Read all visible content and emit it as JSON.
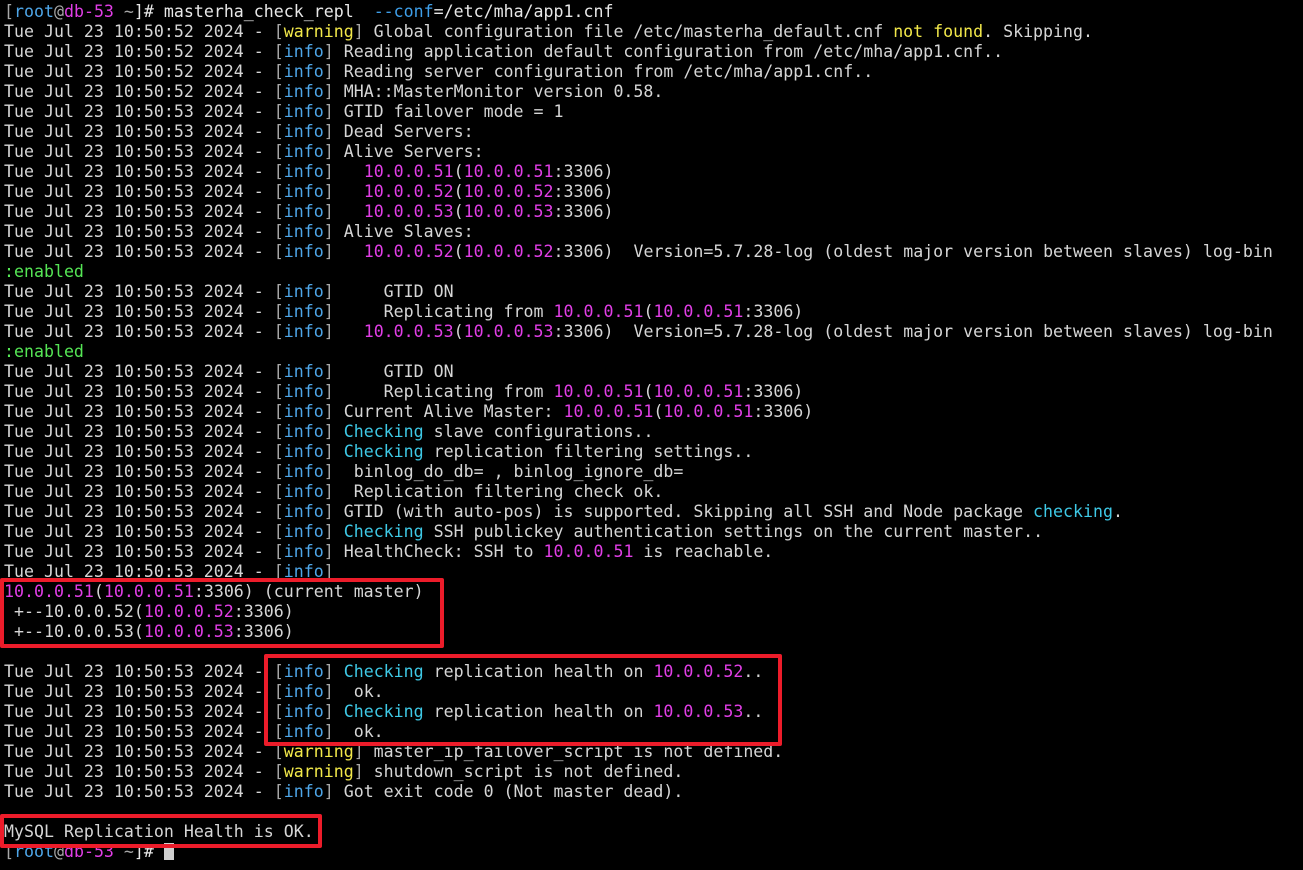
{
  "colors": {
    "background": "#000000",
    "text": "#d6d6d6",
    "warning": "#f2e84a",
    "info": "#4ea6e8",
    "ip": "#e13ee6",
    "keyword": "#3ec9e6",
    "enabled": "#55e655",
    "highlight_box": "#ec1c2a"
  },
  "icons": {
    "cursor": "block-cursor-icon"
  },
  "lines": [
    [
      {
        "t": "[",
        "c": "br"
      },
      {
        "t": "root",
        "c": "user"
      },
      {
        "t": "@",
        "c": "br"
      },
      {
        "t": "db-53",
        "c": "host"
      },
      {
        "t": " ~",
        "c": "br"
      },
      {
        "t": "]# masterha_check_repl  ",
        "c": "path"
      },
      {
        "t": "--conf",
        "c": "opt"
      },
      {
        "t": "=/etc/mha/app1.cnf",
        "c": "path"
      }
    ],
    [
      {
        "t": "Tue Jul 23 10:50:52 2024 - "
      },
      {
        "t": "[",
        "c": "br"
      },
      {
        "t": "warning",
        "c": "warn"
      },
      {
        "t": "]",
        "c": "br"
      },
      {
        "t": " Global configuration file /etc/masterha_default.cnf "
      },
      {
        "t": "not found",
        "c": "nf"
      },
      {
        "t": ". Skipping."
      }
    ],
    [
      {
        "t": "Tue Jul 23 10:50:52 2024 - "
      },
      {
        "t": "[",
        "c": "br"
      },
      {
        "t": "info",
        "c": "info"
      },
      {
        "t": "]",
        "c": "br"
      },
      {
        "t": " Reading application default configuration from /etc/mha/app1.cnf.."
      }
    ],
    [
      {
        "t": "Tue Jul 23 10:50:52 2024 - "
      },
      {
        "t": "[",
        "c": "br"
      },
      {
        "t": "info",
        "c": "info"
      },
      {
        "t": "]",
        "c": "br"
      },
      {
        "t": " Reading server configuration from /etc/mha/app1.cnf.."
      }
    ],
    [
      {
        "t": "Tue Jul 23 10:50:52 2024 - "
      },
      {
        "t": "[",
        "c": "br"
      },
      {
        "t": "info",
        "c": "info"
      },
      {
        "t": "]",
        "c": "br"
      },
      {
        "t": " MHA::MasterMonitor version 0.58."
      }
    ],
    [
      {
        "t": "Tue Jul 23 10:50:53 2024 - "
      },
      {
        "t": "[",
        "c": "br"
      },
      {
        "t": "info",
        "c": "info"
      },
      {
        "t": "]",
        "c": "br"
      },
      {
        "t": " GTID failover mode = 1"
      }
    ],
    [
      {
        "t": "Tue Jul 23 10:50:53 2024 - "
      },
      {
        "t": "[",
        "c": "br"
      },
      {
        "t": "info",
        "c": "info"
      },
      {
        "t": "]",
        "c": "br"
      },
      {
        "t": " Dead Servers:"
      }
    ],
    [
      {
        "t": "Tue Jul 23 10:50:53 2024 - "
      },
      {
        "t": "[",
        "c": "br"
      },
      {
        "t": "info",
        "c": "info"
      },
      {
        "t": "]",
        "c": "br"
      },
      {
        "t": " Alive Servers:"
      }
    ],
    [
      {
        "t": "Tue Jul 23 10:50:53 2024 - "
      },
      {
        "t": "[",
        "c": "br"
      },
      {
        "t": "info",
        "c": "info"
      },
      {
        "t": "]",
        "c": "br"
      },
      {
        "t": "   "
      },
      {
        "t": "10.0.0.51",
        "c": "ip"
      },
      {
        "t": "("
      },
      {
        "t": "10.0.0.51",
        "c": "ip"
      },
      {
        "t": ":3306)"
      }
    ],
    [
      {
        "t": "Tue Jul 23 10:50:53 2024 - "
      },
      {
        "t": "[",
        "c": "br"
      },
      {
        "t": "info",
        "c": "info"
      },
      {
        "t": "]",
        "c": "br"
      },
      {
        "t": "   "
      },
      {
        "t": "10.0.0.52",
        "c": "ip"
      },
      {
        "t": "("
      },
      {
        "t": "10.0.0.52",
        "c": "ip"
      },
      {
        "t": ":3306)"
      }
    ],
    [
      {
        "t": "Tue Jul 23 10:50:53 2024 - "
      },
      {
        "t": "[",
        "c": "br"
      },
      {
        "t": "info",
        "c": "info"
      },
      {
        "t": "]",
        "c": "br"
      },
      {
        "t": "   "
      },
      {
        "t": "10.0.0.53",
        "c": "ip"
      },
      {
        "t": "("
      },
      {
        "t": "10.0.0.53",
        "c": "ip"
      },
      {
        "t": ":3306)"
      }
    ],
    [
      {
        "t": "Tue Jul 23 10:50:53 2024 - "
      },
      {
        "t": "[",
        "c": "br"
      },
      {
        "t": "info",
        "c": "info"
      },
      {
        "t": "]",
        "c": "br"
      },
      {
        "t": " Alive Slaves:"
      }
    ],
    [
      {
        "t": "Tue Jul 23 10:50:53 2024 - "
      },
      {
        "t": "[",
        "c": "br"
      },
      {
        "t": "info",
        "c": "info"
      },
      {
        "t": "]",
        "c": "br"
      },
      {
        "t": "   "
      },
      {
        "t": "10.0.0.52",
        "c": "ip"
      },
      {
        "t": "("
      },
      {
        "t": "10.0.0.52",
        "c": "ip"
      },
      {
        "t": ":3306)  Version=5.7.28-log (oldest major version between slaves) log-bin"
      }
    ],
    [
      {
        "t": ":enabled",
        "c": "en"
      }
    ],
    [
      {
        "t": "Tue Jul 23 10:50:53 2024 - "
      },
      {
        "t": "[",
        "c": "br"
      },
      {
        "t": "info",
        "c": "info"
      },
      {
        "t": "]",
        "c": "br"
      },
      {
        "t": "     GTID ON"
      }
    ],
    [
      {
        "t": "Tue Jul 23 10:50:53 2024 - "
      },
      {
        "t": "[",
        "c": "br"
      },
      {
        "t": "info",
        "c": "info"
      },
      {
        "t": "]",
        "c": "br"
      },
      {
        "t": "     Replicating from "
      },
      {
        "t": "10.0.0.51",
        "c": "ip"
      },
      {
        "t": "("
      },
      {
        "t": "10.0.0.51",
        "c": "ip"
      },
      {
        "t": ":3306)"
      }
    ],
    [
      {
        "t": "Tue Jul 23 10:50:53 2024 - "
      },
      {
        "t": "[",
        "c": "br"
      },
      {
        "t": "info",
        "c": "info"
      },
      {
        "t": "]",
        "c": "br"
      },
      {
        "t": "   "
      },
      {
        "t": "10.0.0.53",
        "c": "ip"
      },
      {
        "t": "("
      },
      {
        "t": "10.0.0.53",
        "c": "ip"
      },
      {
        "t": ":3306)  Version=5.7.28-log (oldest major version between slaves) log-bin"
      }
    ],
    [
      {
        "t": ":enabled",
        "c": "en"
      }
    ],
    [
      {
        "t": "Tue Jul 23 10:50:53 2024 - "
      },
      {
        "t": "[",
        "c": "br"
      },
      {
        "t": "info",
        "c": "info"
      },
      {
        "t": "]",
        "c": "br"
      },
      {
        "t": "     GTID ON"
      }
    ],
    [
      {
        "t": "Tue Jul 23 10:50:53 2024 - "
      },
      {
        "t": "[",
        "c": "br"
      },
      {
        "t": "info",
        "c": "info"
      },
      {
        "t": "]",
        "c": "br"
      },
      {
        "t": "     Replicating from "
      },
      {
        "t": "10.0.0.51",
        "c": "ip"
      },
      {
        "t": "("
      },
      {
        "t": "10.0.0.51",
        "c": "ip"
      },
      {
        "t": ":3306)"
      }
    ],
    [
      {
        "t": "Tue Jul 23 10:50:53 2024 - "
      },
      {
        "t": "[",
        "c": "br"
      },
      {
        "t": "info",
        "c": "info"
      },
      {
        "t": "]",
        "c": "br"
      },
      {
        "t": " Current Alive Master: "
      },
      {
        "t": "10.0.0.51",
        "c": "ip"
      },
      {
        "t": "("
      },
      {
        "t": "10.0.0.51",
        "c": "ip"
      },
      {
        "t": ":3306)"
      }
    ],
    [
      {
        "t": "Tue Jul 23 10:50:53 2024 - "
      },
      {
        "t": "[",
        "c": "br"
      },
      {
        "t": "info",
        "c": "info"
      },
      {
        "t": "]",
        "c": "br"
      },
      {
        "t": " "
      },
      {
        "t": "Checking",
        "c": "kw"
      },
      {
        "t": " slave configurations.."
      }
    ],
    [
      {
        "t": "Tue Jul 23 10:50:53 2024 - "
      },
      {
        "t": "[",
        "c": "br"
      },
      {
        "t": "info",
        "c": "info"
      },
      {
        "t": "]",
        "c": "br"
      },
      {
        "t": " "
      },
      {
        "t": "Checking",
        "c": "kw"
      },
      {
        "t": " replication filtering settings.."
      }
    ],
    [
      {
        "t": "Tue Jul 23 10:50:53 2024 - "
      },
      {
        "t": "[",
        "c": "br"
      },
      {
        "t": "info",
        "c": "info"
      },
      {
        "t": "]",
        "c": "br"
      },
      {
        "t": "  binlog_do_db= , binlog_ignore_db="
      }
    ],
    [
      {
        "t": "Tue Jul 23 10:50:53 2024 - "
      },
      {
        "t": "[",
        "c": "br"
      },
      {
        "t": "info",
        "c": "info"
      },
      {
        "t": "]",
        "c": "br"
      },
      {
        "t": "  Replication filtering check ok."
      }
    ],
    [
      {
        "t": "Tue Jul 23 10:50:53 2024 - "
      },
      {
        "t": "[",
        "c": "br"
      },
      {
        "t": "info",
        "c": "info"
      },
      {
        "t": "]",
        "c": "br"
      },
      {
        "t": " GTID (with auto-pos) is supported. Skipping all SSH and Node package "
      },
      {
        "t": "checking",
        "c": "kw"
      },
      {
        "t": "."
      }
    ],
    [
      {
        "t": "Tue Jul 23 10:50:53 2024 - "
      },
      {
        "t": "[",
        "c": "br"
      },
      {
        "t": "info",
        "c": "info"
      },
      {
        "t": "]",
        "c": "br"
      },
      {
        "t": " "
      },
      {
        "t": "Checking",
        "c": "kw"
      },
      {
        "t": " SSH publickey authentication settings on the current master.."
      }
    ],
    [
      {
        "t": "Tue Jul 23 10:50:53 2024 - "
      },
      {
        "t": "[",
        "c": "br"
      },
      {
        "t": "info",
        "c": "info"
      },
      {
        "t": "]",
        "c": "br"
      },
      {
        "t": " HealthCheck: SSH to "
      },
      {
        "t": "10.0.0.51",
        "c": "ip"
      },
      {
        "t": " is reachable."
      }
    ],
    [
      {
        "t": "Tue Jul 23 10:50:53 2024 - "
      },
      {
        "t": "[",
        "c": "br"
      },
      {
        "t": "info",
        "c": "info"
      },
      {
        "t": "]",
        "c": "br"
      }
    ],
    [
      {
        "t": "10.0.0.51",
        "c": "ip"
      },
      {
        "t": "("
      },
      {
        "t": "10.0.0.51",
        "c": "ip"
      },
      {
        "t": ":3306) (current master)"
      }
    ],
    [
      {
        "t": " +--10.0.0.52("
      },
      {
        "t": "10.0.0.52",
        "c": "ip"
      },
      {
        "t": ":3306)"
      }
    ],
    [
      {
        "t": " +--10.0.0.53("
      },
      {
        "t": "10.0.0.53",
        "c": "ip"
      },
      {
        "t": ":3306)"
      }
    ],
    [],
    [
      {
        "t": "Tue Jul 23 10:50:53 2024 - "
      },
      {
        "t": "[",
        "c": "br"
      },
      {
        "t": "info",
        "c": "info"
      },
      {
        "t": "]",
        "c": "br"
      },
      {
        "t": " "
      },
      {
        "t": "Checking",
        "c": "kw"
      },
      {
        "t": " replication health on "
      },
      {
        "t": "10.0.0.52",
        "c": "ip"
      },
      {
        "t": ".."
      }
    ],
    [
      {
        "t": "Tue Jul 23 10:50:53 2024 - "
      },
      {
        "t": "[",
        "c": "br"
      },
      {
        "t": "info",
        "c": "info"
      },
      {
        "t": "]",
        "c": "br"
      },
      {
        "t": "  ok."
      }
    ],
    [
      {
        "t": "Tue Jul 23 10:50:53 2024 - "
      },
      {
        "t": "[",
        "c": "br"
      },
      {
        "t": "info",
        "c": "info"
      },
      {
        "t": "]",
        "c": "br"
      },
      {
        "t": " "
      },
      {
        "t": "Checking",
        "c": "kw"
      },
      {
        "t": " replication health on "
      },
      {
        "t": "10.0.0.53",
        "c": "ip"
      },
      {
        "t": ".."
      }
    ],
    [
      {
        "t": "Tue Jul 23 10:50:53 2024 - "
      },
      {
        "t": "[",
        "c": "br"
      },
      {
        "t": "info",
        "c": "info"
      },
      {
        "t": "]",
        "c": "br"
      },
      {
        "t": "  ok."
      }
    ],
    [
      {
        "t": "Tue Jul 23 10:50:53 2024 - "
      },
      {
        "t": "[",
        "c": "br"
      },
      {
        "t": "warning",
        "c": "warn"
      },
      {
        "t": "]",
        "c": "br"
      },
      {
        "t": " master_ip_failover_script is not defined."
      }
    ],
    [
      {
        "t": "Tue Jul 23 10:50:53 2024 - "
      },
      {
        "t": "[",
        "c": "br"
      },
      {
        "t": "warning",
        "c": "warn"
      },
      {
        "t": "]",
        "c": "br"
      },
      {
        "t": " shutdown_script is not defined."
      }
    ],
    [
      {
        "t": "Tue Jul 23 10:50:53 2024 - "
      },
      {
        "t": "[",
        "c": "br"
      },
      {
        "t": "info",
        "c": "info"
      },
      {
        "t": "]",
        "c": "br"
      },
      {
        "t": " Got exit code 0 (Not master dead)."
      }
    ],
    [],
    [
      {
        "t": "MySQL Replication Health is OK."
      }
    ],
    [
      {
        "t": "[",
        "c": "br"
      },
      {
        "t": "root",
        "c": "user"
      },
      {
        "t": "@",
        "c": "br"
      },
      {
        "t": "db-53",
        "c": "host"
      },
      {
        "t": " ~",
        "c": "br"
      },
      {
        "t": "]# ",
        "c": "path"
      },
      {
        "t": "",
        "c": "cursor"
      }
    ]
  ]
}
